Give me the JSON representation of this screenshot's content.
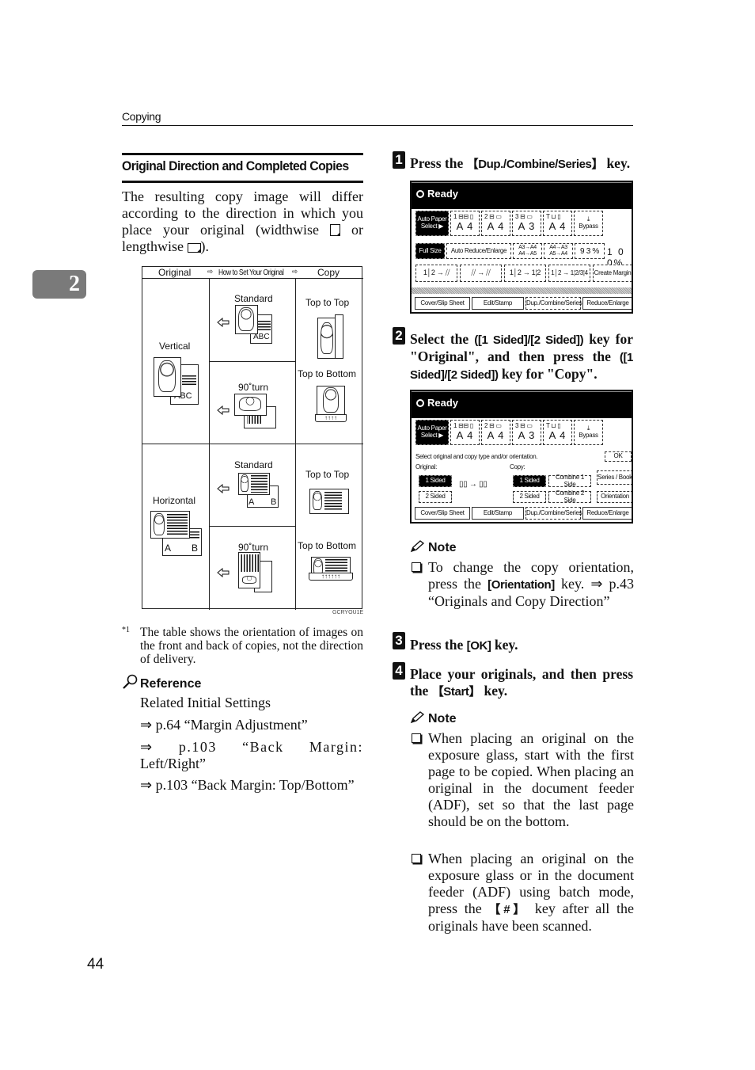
{
  "header": {
    "running_head": "Copying"
  },
  "chapter_tab": {
    "number": "2",
    "color": "#7a7a7a"
  },
  "left": {
    "section_title": "Original Direction and Completed Copies",
    "intro_before_glyph1": "The resulting copy image will differ according to the direction in which you place your original (widthwise ",
    "intro_between_glyphs": " or lengthwise ",
    "intro_after_glyph2": ").",
    "figure": {
      "header_original": "Original",
      "header_how": "How to Set Your Original",
      "header_copy": "Copy",
      "rows": [
        {
          "original": "Vertical",
          "standard_label": "Standard",
          "turn_label": "90˚turn",
          "copy_top": "Top to Top",
          "copy_bottom": "Top to Bottom",
          "doc_label": "ABC"
        },
        {
          "original": "Horizontal",
          "standard_label": "Standard",
          "turn_label": "90˚turn",
          "copy_top": "Top to Top",
          "copy_bottom": "Top to Bottom",
          "doc_label_a": "A",
          "doc_label_b": "B"
        }
      ],
      "code": "GCRYOU1E"
    },
    "footnote_mark": "*1",
    "footnote": "The table shows the orientation of images on the front and back of copies, not the direction of delivery.",
    "reference": {
      "title": "Reference",
      "subtitle": "Related Initial Settings",
      "links": [
        "⇒ p.64 “Margin Adjustment”",
        "⇒ p.103 “Back Margin:",
        "Left/Right”",
        "⇒ p.103 “Back Margin: Top/Bottom”"
      ]
    }
  },
  "steps": [
    {
      "number": "1",
      "pre": "Press the ",
      "key": "【Dup./Combine/Series】",
      "post": " key."
    },
    {
      "number": "2",
      "line1_key": "([1 Sided]/[2 Sided])",
      "line1_post": " key for \"Original\", and then press the ",
      "line2_key": "([1 Sided]/[2 Sided])",
      "line2_post": " key for \"Copy\"."
    },
    {
      "number": "3",
      "pre": "Press the ",
      "key": "[OK]",
      "post": " key."
    },
    {
      "number": "4",
      "pre": "Place your originals, and then press the ",
      "key": "【Start】",
      "post": " key."
    }
  ],
  "screen1": {
    "status": "Ready",
    "paper_buttons": [
      {
        "label1": "Auto Paper",
        "label2": "Select ▶"
      },
      {
        "tray": "1 ⊟⊟ ▯",
        "size": "A 4"
      },
      {
        "tray": "2 ⊟ ▭",
        "size": "A 4"
      },
      {
        "tray": "3 ⊟ ▭",
        "size": "A 3"
      },
      {
        "tray": "T ⊔ ▯",
        "size": "A 4"
      },
      {
        "tray": "⤓",
        "size": "Bypass"
      }
    ],
    "ratio_buttons": [
      "Full Size",
      "Auto Reduce/Enlarge",
      "A3→A4 A4→A5",
      "A4→A3 A5→A4",
      "9 3 %"
    ],
    "ratio_value": "1 0 0%",
    "mode_buttons": [
      "1│2 → ⧸⧸",
      "⧸⧸ → ⧸⧸",
      "1│2 → 1¦2",
      "1│2 → 1¦2/3¦4",
      "Create Margin"
    ],
    "tabs": [
      "Cover/Slip Sheet",
      "Edit/Stamp",
      "Dup./Combine/Series",
      "Reduce/Enlarge"
    ]
  },
  "screen2": {
    "status": "Ready",
    "paper_buttons": [
      {
        "label1": "Auto Paper",
        "label2": "Select ▶"
      },
      {
        "tray": "1 ⊟⊟ ▯",
        "size": "A 4"
      },
      {
        "tray": "2 ⊟ ▭",
        "size": "A 4"
      },
      {
        "tray": "3 ⊟ ▭",
        "size": "A 3"
      },
      {
        "tray": "T ⊔ ▯",
        "size": "A 4"
      },
      {
        "tray": "⤓",
        "size": "Bypass"
      }
    ],
    "instruction": "Select original and copy type and/or orientation.",
    "ok_label": "OK",
    "original_label": "Original:",
    "copy_label": "Copy:",
    "original_options": [
      "1 Sided",
      "2 Sided"
    ],
    "copy_options": [
      "1 Sided",
      "2 Sided"
    ],
    "combine_options": [
      "Combine 1 Side",
      "Combine 2 Side"
    ],
    "side_buttons": [
      "Series / Book",
      "Orientation"
    ],
    "tabs": [
      "Cover/Slip Sheet",
      "Edit/Stamp",
      "Dup./Combine/Series",
      "Reduce/Enlarge"
    ]
  },
  "note1": {
    "title": "Note",
    "items": [
      {
        "pre": "To change the copy orientation, press the ",
        "key": "[Orientation]",
        "post": " key. ⇒ p.43 “Originals and Copy Direction”"
      }
    ]
  },
  "note2": {
    "title": "Note",
    "items": [
      {
        "text": "When placing an original on the exposure glass, start with the first page to be copied. When placing an original in the document feeder (ADF), set so that the last page should be on the bottom."
      },
      {
        "pre": "When placing an original on the exposure glass or in the document feeder (ADF) using batch mode, press the ",
        "key": "【#】",
        "post": " key after all the originals have been scanned."
      }
    ]
  },
  "page_number": "44"
}
